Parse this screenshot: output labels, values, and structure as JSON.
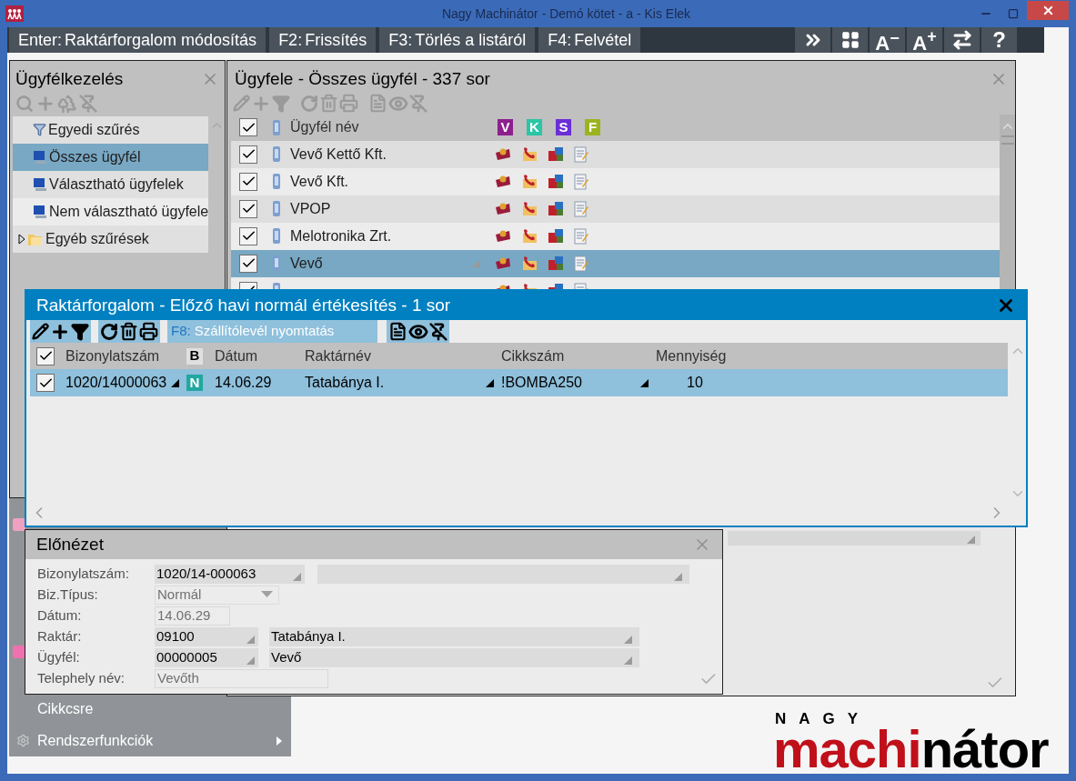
{
  "window": {
    "title": "Nagy Machinátor - Demó kötet - a - Kis Elek"
  },
  "toolbar": {
    "commands": [
      {
        "key": "Enter:",
        "label": "Raktárforgalom módosítás"
      },
      {
        "key": "F2:",
        "label": "Frissítés"
      },
      {
        "key": "F3:",
        "label": "Törlés a listáról"
      },
      {
        "key": "F4:",
        "label": "Felvétel"
      }
    ],
    "view_buttons": [
      {
        "kind": "more"
      },
      {
        "kind": "layout"
      },
      {
        "kind": "font_smaller",
        "label": "A",
        "sign": "−"
      },
      {
        "kind": "font_larger",
        "label": "A",
        "sign": "+"
      },
      {
        "kind": "switch"
      },
      {
        "kind": "help",
        "label": "?"
      }
    ]
  },
  "sidebar": {
    "title": "Ügyfélkezelés",
    "items": [
      {
        "label": "Egyedi szűrés",
        "kind": "filter",
        "selected": false
      },
      {
        "label": "Összes ügyfél",
        "kind": "computer",
        "selected": true
      },
      {
        "label": "Választható ügyfelek",
        "kind": "computer",
        "selected": false
      },
      {
        "label": "Nem választható ügyfele",
        "kind": "computer",
        "selected": false
      },
      {
        "label": "Egyéb szűrések",
        "kind": "folder",
        "selected": false,
        "expanded": false
      }
    ]
  },
  "menu": {
    "items": [
      {
        "label": "Cikkcsre",
        "has_submenu": false
      },
      {
        "label": "Rendszerfunkciók",
        "has_submenu": true
      }
    ]
  },
  "customer_list": {
    "title": "Ügyfele - Összes ügyfél - 337 sor",
    "name_column": "Ügyfél név",
    "all_checked": true,
    "flag_columns": [
      {
        "label": "V",
        "color": "#8e1f8e"
      },
      {
        "label": "K",
        "color": "#2ac6a6"
      },
      {
        "label": "S",
        "color": "#6a2fd6"
      },
      {
        "label": "F",
        "color": "#9bb41e"
      }
    ],
    "rows": [
      {
        "name": "Vevő Kettő Kft.",
        "checked": true,
        "selected": false
      },
      {
        "name": "Vevő Kft.",
        "checked": true,
        "selected": false
      },
      {
        "name": "VPOP",
        "checked": true,
        "selected": false
      },
      {
        "name": "Melotronika Zrt.",
        "checked": true,
        "selected": false
      },
      {
        "name": "Vevő",
        "checked": true,
        "selected": true
      },
      {
        "checked": true,
        "selected": false
      }
    ]
  },
  "stock_dialog": {
    "title": "Raktárforgalom - Előző havi normál értékesítés - 1 sor",
    "shortcut": {
      "key": "F8:",
      "label": "Szállítólevél nyomtatás"
    },
    "columns": [
      "Bizonylatszám",
      "B",
      "Dátum",
      "Raktárnév",
      "Cikkszám",
      "Mennyiség"
    ],
    "all_checked": true,
    "rows": [
      {
        "checked": true,
        "selected": true,
        "cells": [
          "1020/14000063",
          "N",
          "14.06.29",
          "Tatabánya I.",
          "!BOMBA250",
          "10"
        ]
      }
    ]
  },
  "preview": {
    "title": "Előnézet",
    "fields": [
      {
        "label": "Bizonylatszám:",
        "kind": "lookup",
        "value": "1020/14-000063",
        "disabled": false,
        "extra": {
          "kind": "lookup"
        }
      },
      {
        "label": "Biz.Típus:",
        "kind": "dropdown",
        "value": "Normál",
        "disabled": true
      },
      {
        "label": "Dátum:",
        "kind": "text",
        "value": "14.06.29",
        "disabled": true
      },
      {
        "label": "Raktár:",
        "kind": "lookup",
        "value": "09100",
        "disabled": false,
        "extra": {
          "kind": "lookup",
          "value": "Tatabánya I."
        }
      },
      {
        "label": "Ügyfél:",
        "kind": "lookup",
        "value": "00000005",
        "disabled": false,
        "extra": {
          "kind": "lookup",
          "value": "Vevő"
        }
      },
      {
        "label": "Telephely név:",
        "kind": "text",
        "value": "Vevőth",
        "disabled": true
      }
    ]
  },
  "logo": {
    "top": "NAGY",
    "red_part": "machi",
    "black_part": "nátor"
  }
}
